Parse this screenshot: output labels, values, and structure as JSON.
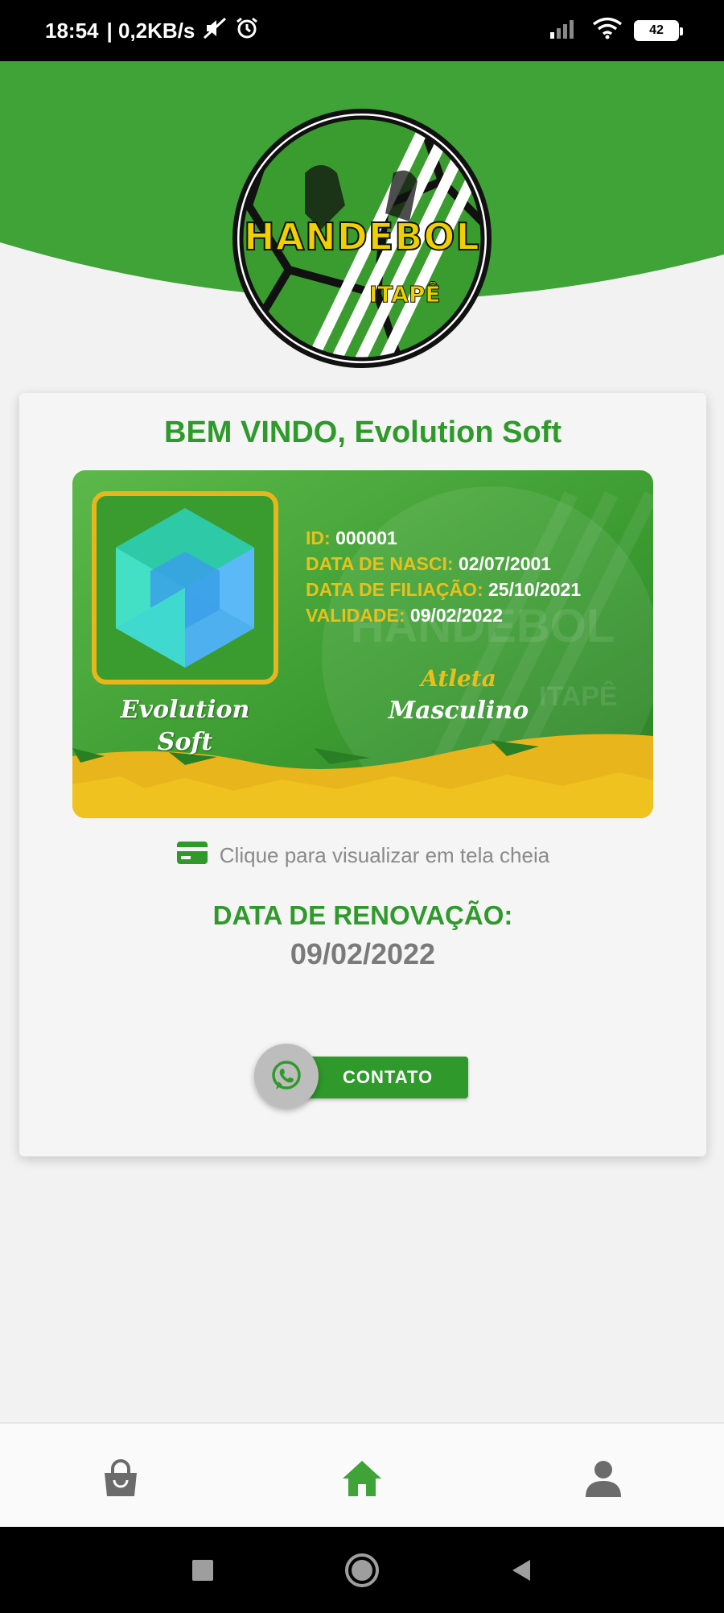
{
  "status_bar": {
    "time": "18:54",
    "network_speed": "| 0,2KB/s",
    "icons_left": [
      "mute-icon",
      "alarm-icon"
    ],
    "icons_right": [
      "signal-icon",
      "wifi-icon"
    ],
    "battery_level": "42"
  },
  "header": {
    "logo_main_text": "HANDEBOL",
    "logo_sub_text": "ITAPÊ",
    "colors": {
      "primary_green": "#3fa337",
      "accent_yellow": "#f0d000"
    }
  },
  "welcome_text": "BEM VINDO, Evolution Soft",
  "member_card": {
    "name_line1": "Evolution",
    "name_line2": "Soft",
    "fields": [
      {
        "label": "ID:",
        "value": "000001"
      },
      {
        "label": "DATA DE NASCI:",
        "value": "02/07/2001"
      },
      {
        "label": "DATA DE FILIAÇÃO:",
        "value": "25/10/2021"
      },
      {
        "label": "VALIDADE:",
        "value": "09/02/2022"
      }
    ],
    "category": "Atleta",
    "gender": "Masculino",
    "watermark_main": "HANDEBOL",
    "watermark_sub": "ITAPÊ"
  },
  "fullscreen_hint": "Clique para visualizar em tela cheia",
  "renewal": {
    "title": "DATA DE RENOVAÇÃO:",
    "date": "09/02/2022"
  },
  "contact_button": {
    "label": "CONTATO",
    "icon": "whatsapp-icon"
  },
  "bottom_nav": {
    "items": [
      {
        "name": "shop",
        "icon": "shopping-bag-icon",
        "active": false
      },
      {
        "name": "home",
        "icon": "home-icon",
        "active": true
      },
      {
        "name": "profile",
        "icon": "user-icon",
        "active": false
      }
    ],
    "active_color": "#3fa337",
    "inactive_color": "#6b6b6b"
  },
  "system_nav": [
    "recents-icon",
    "home-circle-icon",
    "back-icon"
  ]
}
